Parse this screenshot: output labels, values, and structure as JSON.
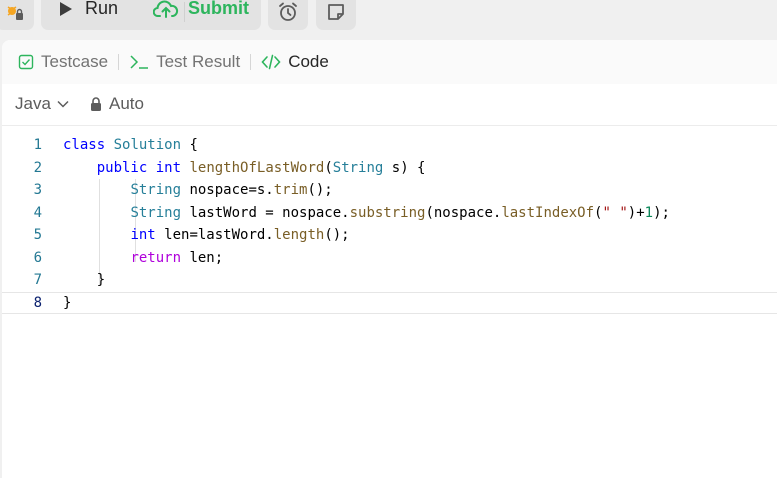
{
  "toolbar": {
    "run_label": "Run",
    "submit_label": "Submit"
  },
  "tabs": [
    {
      "label": "Testcase",
      "icon": "checkbox-icon"
    },
    {
      "label": "Test Result",
      "icon": "terminal-icon"
    },
    {
      "label": "Code",
      "icon": "code-icon"
    }
  ],
  "editor_settings": {
    "language": "Java",
    "mode": "Auto"
  },
  "code": {
    "line_numbers": [
      "1",
      "2",
      "3",
      "4",
      "5",
      "6",
      "7",
      "8"
    ],
    "lines": [
      "class Solution {",
      "    public int lengthOfLastWord(String s) {",
      "        String nospace=s.trim();",
      "        String lastWord = nospace.substring(nospace.lastIndexOf(\" \")+1);",
      "        int len=lastWord.length();",
      "        return len;",
      "    }",
      "}"
    ]
  },
  "colors": {
    "accent_green": "#2db55d",
    "keyword": "#0000ff",
    "type": "#267f99",
    "function": "#795e26",
    "string": "#a31515",
    "number": "#098658",
    "line_number": "#237893"
  }
}
